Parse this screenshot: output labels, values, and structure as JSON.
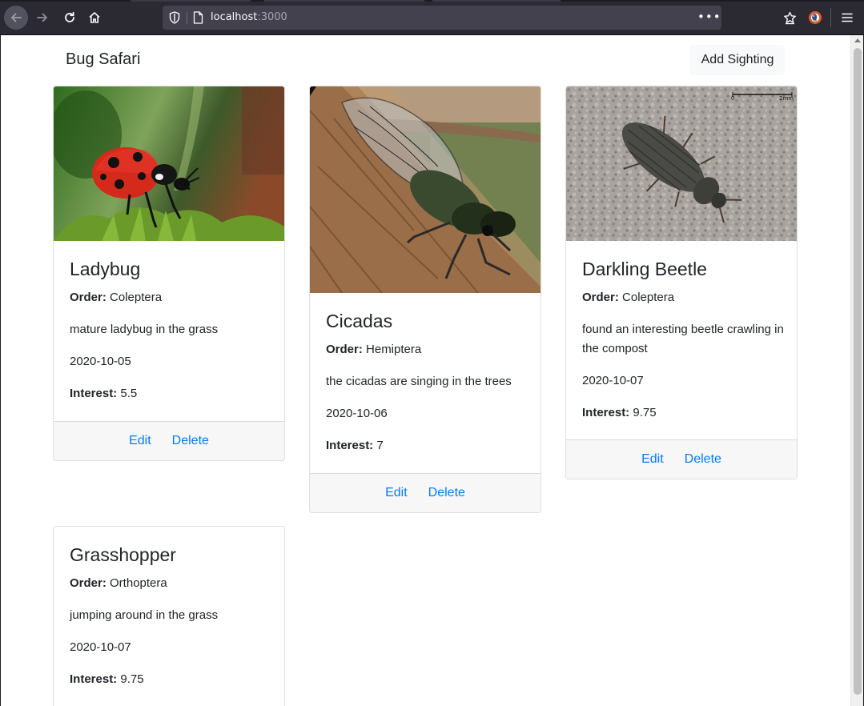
{
  "browser": {
    "url_host": "localhost",
    "url_port": ":3000",
    "menu_dots": "•••"
  },
  "app": {
    "brand": "Bug Safari",
    "add_button": "Add Sighting"
  },
  "labels": {
    "order": "Order:",
    "interest": "Interest:",
    "edit": "Edit",
    "delete": "Delete"
  },
  "cards": [
    {
      "name": "Ladybug",
      "order": "Coleptera",
      "description": "mature ladybug in the grass",
      "date": "2020-10-05",
      "interest": "5.5"
    },
    {
      "name": "Cicadas",
      "order": "Hemiptera",
      "description": "the cicadas are singing in the trees",
      "date": "2020-10-06",
      "interest": "7"
    },
    {
      "name": "Darkling Beetle",
      "order": "Coleptera",
      "description": "found an interesting beetle crawling in the compost",
      "date": "2020-10-07",
      "interest": "9.75",
      "scale_label_zero": "0",
      "scale_label_max": "2mm"
    },
    {
      "name": "Grasshopper",
      "order": "Orthoptera",
      "description": "jumping around in the grass",
      "date": "2020-10-07",
      "interest": "9.75"
    }
  ],
  "colors": {
    "link": "#007bff",
    "chrome_bg": "#2b2a33",
    "urlbar_bg": "#42414d"
  }
}
